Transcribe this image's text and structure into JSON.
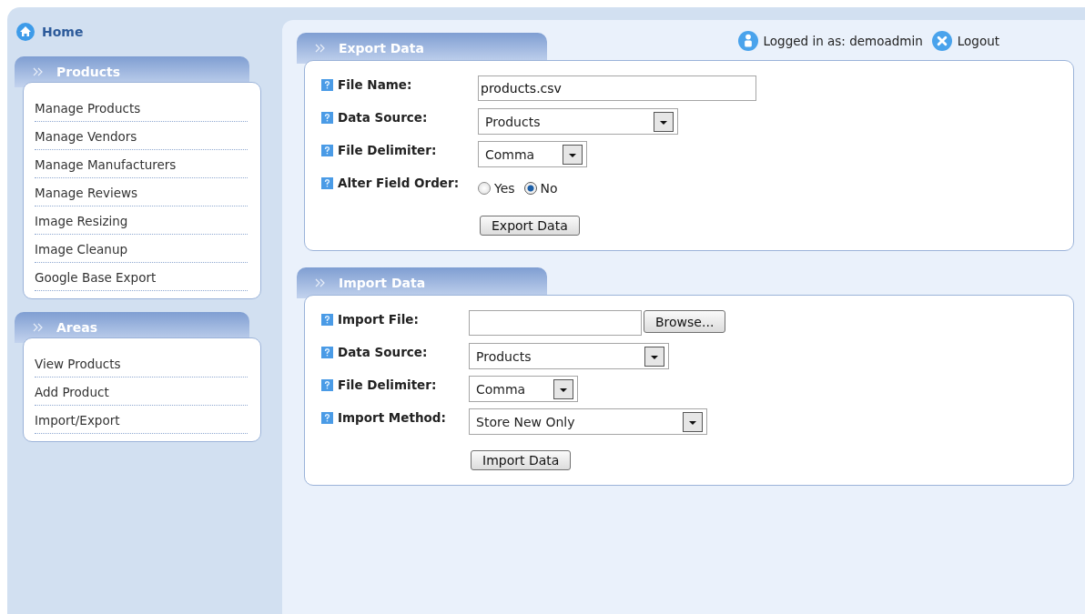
{
  "sidebar": {
    "home": "Home",
    "sections": [
      {
        "title": "Products",
        "items": [
          "Manage Products",
          "Manage Vendors",
          "Manage Manufacturers",
          "Manage Reviews",
          "Image Resizing",
          "Image Cleanup",
          "Google Base Export"
        ]
      },
      {
        "title": "Areas",
        "items": [
          "View Products",
          "Add Product",
          "Import/Export"
        ]
      }
    ]
  },
  "user_bar": {
    "logged_in": "Logged in as: demoadmin",
    "logout": "Logout"
  },
  "panels": [
    {
      "title": "Export Data",
      "fields": [
        {
          "kind": "text",
          "label": "File Name:",
          "value": "products.csv"
        },
        {
          "kind": "select",
          "label": "Data Source:",
          "value": "Products"
        },
        {
          "kind": "select",
          "label": "File Delimiter:",
          "value": "Comma"
        },
        {
          "kind": "radio",
          "label": "Alter Field Order:",
          "options": [
            {
              "label": "Yes",
              "selected": false
            },
            {
              "label": "No",
              "selected": true
            }
          ]
        }
      ],
      "button": "Export Data"
    },
    {
      "title": "Import Data",
      "fields": [
        {
          "kind": "file",
          "label": "Import File:",
          "button": "Browse..."
        },
        {
          "kind": "select",
          "label": "Data Source:",
          "value": "Products"
        },
        {
          "kind": "select",
          "label": "File Delimiter:",
          "value": "Comma"
        },
        {
          "kind": "select",
          "label": "Import Method:",
          "value": "Store New Only"
        }
      ],
      "button": "Import Data"
    }
  ]
}
